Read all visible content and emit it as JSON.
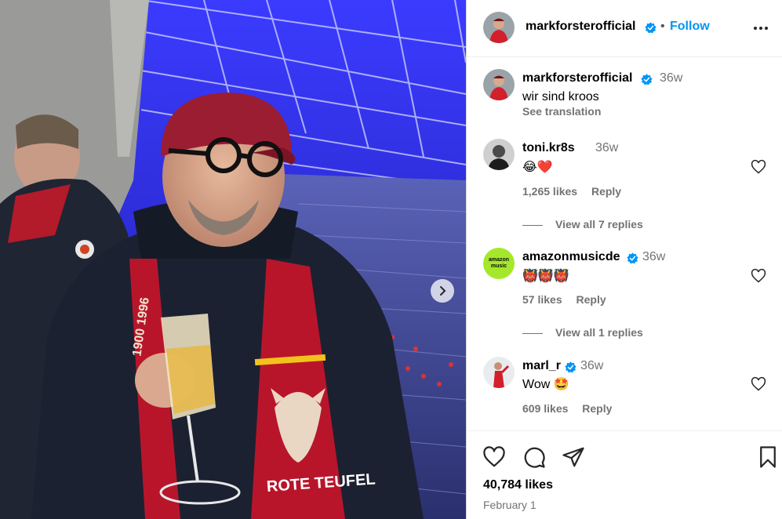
{
  "post": {
    "author": "markforsterofficial",
    "follow_label": "Follow",
    "separator": "•",
    "caption": "wir sind kroos",
    "time": "36w",
    "see_translation": "See translation",
    "likes": "40,784 likes",
    "date": "February 1"
  },
  "photo": {
    "scarf_text": "ROTE TEUFEL",
    "scarf_year": "1900 1996",
    "next_icon": "chevron-right-icon"
  },
  "comments": [
    {
      "user": "toni.kr8s",
      "verified": false,
      "time": "36w",
      "text": "😂❤️",
      "likes": "1,265 likes",
      "reply": "Reply",
      "view_replies": "View all 7 replies"
    },
    {
      "user": "amazonmusicde",
      "verified": true,
      "time": "36w",
      "text": "👹👹👹",
      "likes": "57 likes",
      "reply": "Reply",
      "view_replies": "View all 1 replies"
    },
    {
      "user": "marl_r",
      "verified": true,
      "time": "36w",
      "text": "Wow 🤩",
      "likes": "609 likes",
      "reply": "Reply"
    }
  ],
  "amazon_avatar_text": "amazon music",
  "icons": {
    "like": "heart-icon",
    "comment": "comment-icon",
    "share": "share-icon",
    "save": "bookmark-icon",
    "more": "more-options-icon"
  },
  "colors": {
    "accent": "#0095f6",
    "verified": "#0095f6",
    "muted": "#737373",
    "amazon_green": "#a5e82b"
  }
}
